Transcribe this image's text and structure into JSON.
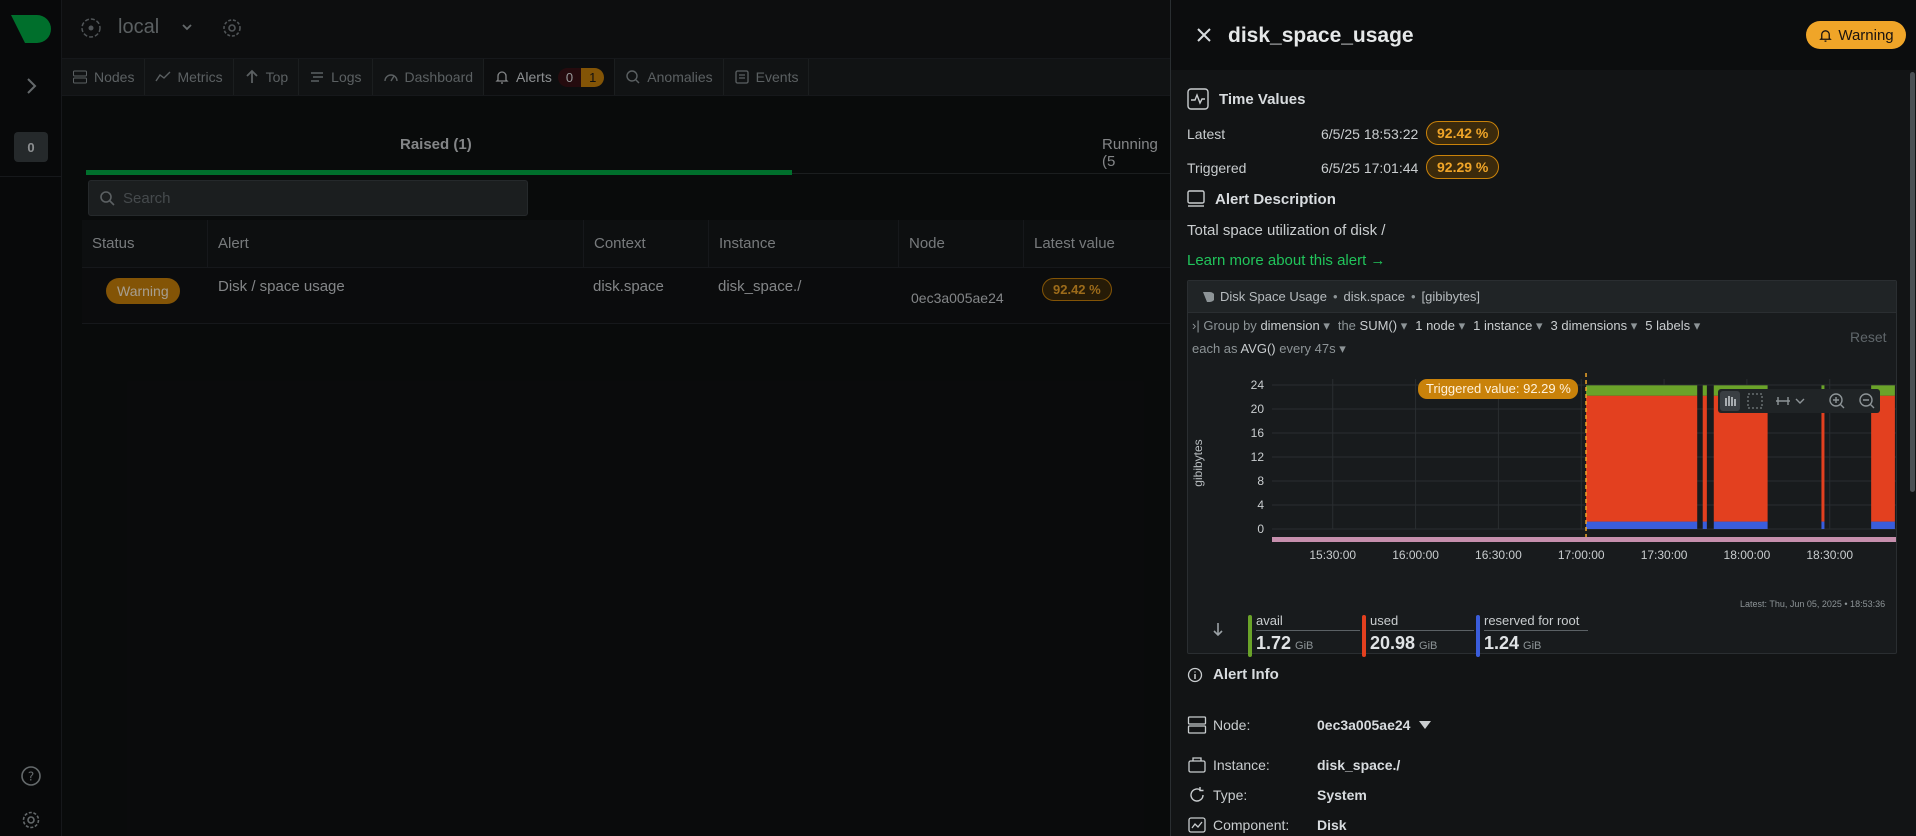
{
  "space": {
    "name": "local"
  },
  "tabs": [
    {
      "label": "Nodes",
      "icon": "server-icon"
    },
    {
      "label": "Metrics",
      "icon": "metrics-icon"
    },
    {
      "label": "Top",
      "icon": "arrow-up-icon"
    },
    {
      "label": "Logs",
      "icon": "logs-icon"
    },
    {
      "label": "Dashboard",
      "icon": "dashboard-icon"
    },
    {
      "label": "Alerts",
      "icon": "bell-icon",
      "critical_count": "0",
      "warning_count": "1"
    },
    {
      "label": "Anomalies",
      "icon": "anomalies-icon"
    },
    {
      "label": "Events",
      "icon": "events-icon"
    }
  ],
  "rail": {
    "notifications_count": "0"
  },
  "alerts_view": {
    "raised_tab": "Raised (1)",
    "running_tab": "Running (5",
    "search_placeholder": "Search",
    "columns": [
      "Status",
      "Alert",
      "Context",
      "Instance",
      "Node",
      "Latest value"
    ],
    "rows": [
      {
        "status": "Warning",
        "alert": "Disk / space usage",
        "context": "disk.space",
        "instance": "disk_space./",
        "node": "0ec3a005ae24",
        "latest_value": "92.42 %"
      }
    ]
  },
  "panel": {
    "title": "disk_space_usage",
    "status_chip": "Warning",
    "time_values": {
      "title": "Time Values",
      "latest_label": "Latest",
      "latest_time": "6/5/25 18:53:22",
      "latest_value": "92.42 %",
      "triggered_label": "Triggered",
      "triggered_time": "6/5/25 17:01:44",
      "triggered_value": "92.29 %"
    },
    "description": {
      "title": "Alert Description",
      "text": "Total space utilization of disk /",
      "learn_more": "Learn more about this alert →"
    },
    "chart": {
      "title": "Disk Space Usage",
      "context": "disk.space",
      "units": "[gibibytes]",
      "group_by_prefix": "Group by",
      "group_by": "dimension",
      "agg_prefix": "the",
      "agg": "SUM()",
      "nodes": "1 node",
      "instances": "1 instance",
      "dimensions": "3 dimensions",
      "labels": "5 labels",
      "each_as_prefix": "each as",
      "each_as": "AVG()",
      "every": "every 47s",
      "reset": "Reset",
      "triggered_label": "Triggered value:",
      "triggered_value": "92.29 %",
      "latest_note": "Latest: Thu, Jun 05, 2025 • 18:53:36"
    },
    "legend": [
      {
        "name": "avail",
        "value": "1.72",
        "unit": "GiB",
        "color": "#6aa329"
      },
      {
        "name": "used",
        "value": "20.98",
        "unit": "GiB",
        "color": "#e3401f"
      },
      {
        "name": "reserved for root",
        "value": "1.24",
        "unit": "GiB",
        "color": "#3a5ddb"
      }
    ],
    "alert_info": {
      "title": "Alert Info",
      "node_label": "Node:",
      "node_value": "0ec3a005ae24",
      "instance_label": "Instance:",
      "instance_value": "disk_space./",
      "type_label": "Type:",
      "type_value": "System",
      "component_label": "Component:",
      "component_value": "Disk"
    }
  },
  "chart_data": {
    "type": "area",
    "title": "Disk Space Usage",
    "ylabel": "gibibytes",
    "ylim": [
      0,
      25
    ],
    "y_ticks": [
      0,
      4,
      8,
      12,
      16,
      20,
      24
    ],
    "x_ticks": [
      "15:30:00",
      "16:00:00",
      "16:30:00",
      "17:00:00",
      "17:30:00",
      "18:00:00",
      "18:30:00"
    ],
    "stacked": true,
    "segments": [
      {
        "start": "17:01:44",
        "end": "17:42:00"
      },
      {
        "start": "17:44:00",
        "end": "17:45:30"
      },
      {
        "start": "17:48:00",
        "end": "18:07:30"
      },
      {
        "start": "18:27:00",
        "end": "18:27:30"
      },
      {
        "start": "18:45:00",
        "end": "18:53:36"
      }
    ],
    "series": [
      {
        "name": "reserved for root",
        "color": "#3a5ddb",
        "value": 1.24
      },
      {
        "name": "used",
        "color": "#e3401f",
        "value": 20.98
      },
      {
        "name": "avail",
        "color": "#6aa329",
        "value": 1.72
      }
    ],
    "triggered_at": "17:01:44",
    "x_domain": [
      "15:08:00",
      "18:54:00"
    ]
  },
  "colors": {
    "accent": "#00ab44",
    "warning": "#f0a528",
    "panel_bg": "#121415"
  }
}
